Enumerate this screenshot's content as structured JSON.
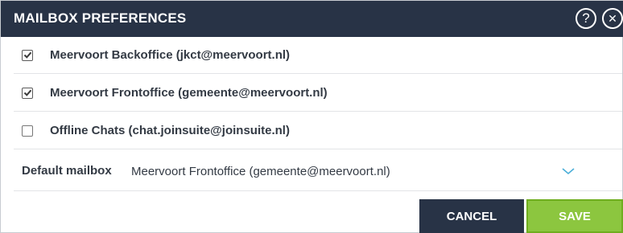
{
  "dialog": {
    "title": "MAILBOX PREFERENCES",
    "help_icon": "help-icon",
    "help_glyph": "?",
    "close_icon": "close-icon",
    "close_glyph": "✕"
  },
  "mailboxes": [
    {
      "label": "Meervoort Backoffice (jkct@meervoort.nl)",
      "checked": true
    },
    {
      "label": "Meervoort Frontoffice (gemeente@meervoort.nl)",
      "checked": true
    },
    {
      "label": "Offline Chats (chat.joinsuite@joinsuite.nl)",
      "checked": false
    }
  ],
  "default_mailbox": {
    "label": "Default mailbox",
    "value": "Meervoort Frontoffice (gemeente@meervoort.nl)",
    "chevron_icon": "chevron-down-icon"
  },
  "buttons": {
    "cancel": "CANCEL",
    "save": "SAVE"
  },
  "colors": {
    "header_bg": "#283346",
    "cancel_bg": "#283346",
    "save_bg": "#8cc63f",
    "chevron": "#4aaed8"
  }
}
